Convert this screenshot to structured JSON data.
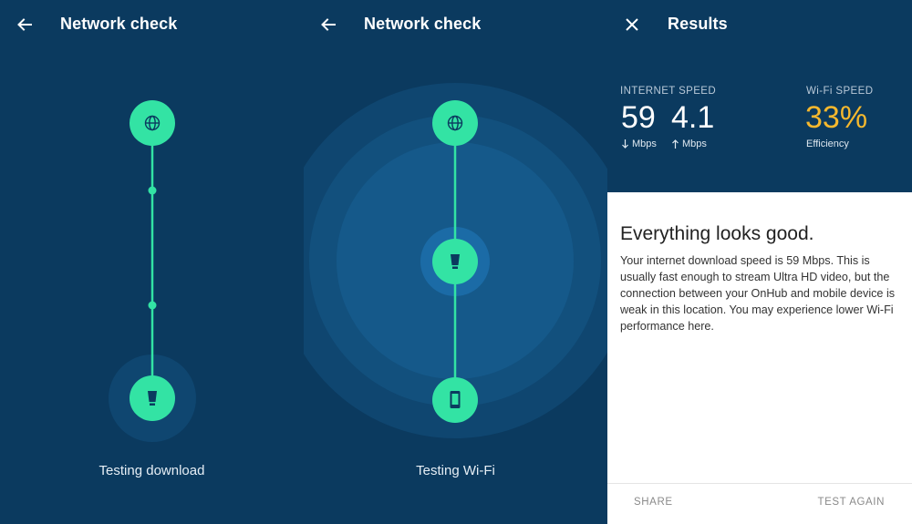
{
  "colors": {
    "panel_bg": "#0b3a5f",
    "node": "#33e3a4",
    "line": "#33e3a4",
    "wifi_accent": "#f5b82e",
    "ring_outer": "#0f4670",
    "ring_mid": "#12507d",
    "ring_inner": "#15598a"
  },
  "screen1": {
    "nav_icon": "arrow-left-icon",
    "title": "Network check",
    "status": "Testing download"
  },
  "screen2": {
    "nav_icon": "arrow-left-icon",
    "title": "Network check",
    "status": "Testing Wi-Fi"
  },
  "screen3": {
    "nav_icon": "close-icon",
    "title": "Results",
    "internet_speed": {
      "label": "INTERNET SPEED",
      "download": "59",
      "upload": "4.1",
      "download_unit": "Mbps",
      "upload_unit": "Mbps"
    },
    "wifi_speed": {
      "label": "Wi-Fi SPEED",
      "value": "33%",
      "sublabel": "Efficiency"
    },
    "card": {
      "title": "Everything looks good.",
      "body": "Your internet download speed is 59 Mbps. This is usually fast enough to stream Ultra HD video, but the connection between your OnHub and mobile device is weak in this location. You may experience lower Wi-Fi performance here.",
      "share": "SHARE",
      "test_again": "TEST AGAIN"
    }
  }
}
